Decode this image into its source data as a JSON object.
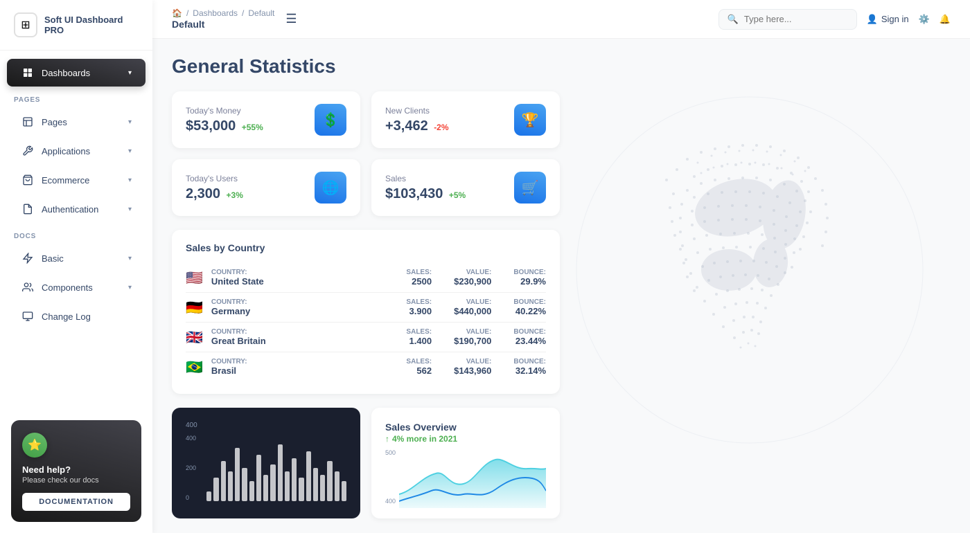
{
  "app": {
    "name": "Soft UI Dashboard PRO"
  },
  "sidebar": {
    "logo_icon": "⊞",
    "pages_label": "PAGES",
    "docs_label": "DOCS",
    "items": [
      {
        "id": "dashboards",
        "label": "Dashboards",
        "icon": "⊡",
        "active": true,
        "has_chevron": true
      },
      {
        "id": "pages",
        "label": "Pages",
        "icon": "📊",
        "active": false,
        "has_chevron": true
      },
      {
        "id": "applications",
        "label": "Applications",
        "icon": "🔧",
        "active": false,
        "has_chevron": true
      },
      {
        "id": "ecommerce",
        "label": "Ecommerce",
        "icon": "🏷",
        "active": false,
        "has_chevron": true
      },
      {
        "id": "authentication",
        "label": "Authentication",
        "icon": "📄",
        "active": false,
        "has_chevron": true
      },
      {
        "id": "basic",
        "label": "Basic",
        "icon": "🚀",
        "active": false,
        "has_chevron": true
      },
      {
        "id": "components",
        "label": "Components",
        "icon": "👤",
        "active": false,
        "has_chevron": true
      },
      {
        "id": "changelog",
        "label": "Change Log",
        "icon": "📋",
        "active": false,
        "has_chevron": false
      }
    ],
    "help_card": {
      "title": "Need help?",
      "subtitle": "Please check our docs",
      "button_label": "DOCUMENTATION"
    }
  },
  "topbar": {
    "breadcrumb": {
      "home_icon": "🏠",
      "items": [
        "Dashboards",
        "Default"
      ],
      "current": "Default"
    },
    "search_placeholder": "Type here...",
    "signin_label": "Sign in",
    "hamburger_icon": "☰"
  },
  "main": {
    "title": "General Statistics",
    "stats": [
      {
        "label": "Today's Money",
        "value": "$53,000",
        "badge": "+55%",
        "badge_type": "pos",
        "icon": "💲",
        "icon_class": "blue"
      },
      {
        "label": "New Clients",
        "value": "+3,462",
        "badge": "-2%",
        "badge_type": "neg",
        "icon": "🏆",
        "icon_class": "blue"
      },
      {
        "label": "Today's Users",
        "value": "2,300",
        "badge": "+3%",
        "badge_type": "pos",
        "icon": "🌐",
        "icon_class": "blue"
      },
      {
        "label": "Sales",
        "value": "$103,430",
        "badge": "+5%",
        "badge_type": "pos",
        "icon": "🛒",
        "icon_class": "blue"
      }
    ],
    "sales_by_country": {
      "title": "Sales by Country",
      "columns": [
        "Country:",
        "Sales:",
        "Value:",
        "Bounce:"
      ],
      "rows": [
        {
          "country": "United State",
          "flag": "🇺🇸",
          "sales": "2500",
          "value": "$230,900",
          "bounce": "29.9%"
        },
        {
          "country": "Germany",
          "flag": "🇩🇪",
          "sales": "3.900",
          "value": "$440,000",
          "bounce": "40.22%"
        },
        {
          "country": "Great Britain",
          "flag": "🇬🇧",
          "sales": "1.400",
          "value": "$190,700",
          "bounce": "23.44%"
        },
        {
          "country": "Brasil",
          "flag": "🇧🇷",
          "sales": "562",
          "value": "$143,960",
          "bounce": "32.14%"
        }
      ]
    },
    "bar_chart": {
      "y_labels": [
        "400",
        "200",
        "0"
      ],
      "bars": [
        15,
        35,
        60,
        45,
        80,
        50,
        30,
        70,
        40,
        55,
        85,
        45,
        65,
        35,
        75,
        50,
        40,
        60,
        45,
        30
      ]
    },
    "sales_overview": {
      "title": "Sales Overview",
      "subtitle": "4% more in 2021",
      "y_labels": [
        "500",
        "400"
      ]
    }
  }
}
